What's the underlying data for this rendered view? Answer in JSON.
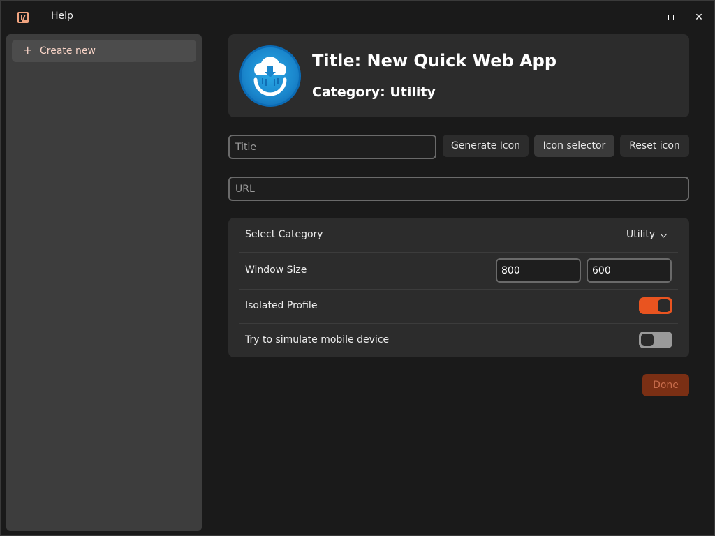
{
  "titlebar": {
    "logo_icon": "app-logo-icon",
    "help_label": "Help",
    "minimize_icon": "minimize-icon",
    "maximize_icon": "maximize-icon",
    "close_glyph": "✕"
  },
  "sidebar": {
    "create_new_icon": "plus-icon",
    "create_new_glyph": "+",
    "create_new_label": "Create new"
  },
  "header": {
    "title": "Title: New Quick Web App",
    "category": "Category: Utility"
  },
  "form": {
    "title_placeholder": "Title",
    "url_placeholder": "URL",
    "generate_icon_label": "Generate Icon",
    "icon_selector_label": "Icon selector",
    "reset_icon_label": "Reset icon"
  },
  "settings": {
    "category_label": "Select Category",
    "category_value": "Utility",
    "window_size_label": "Window Size",
    "window_width": "800",
    "window_height": "600",
    "isolated_label": "Isolated Profile",
    "isolated_enabled": true,
    "mobile_label": "Try to simulate mobile device",
    "mobile_enabled": false
  },
  "footer": {
    "done_label": "Done"
  },
  "colors": {
    "accent": "#e95420",
    "background": "#1a1a1a",
    "card": "#2c2c2c",
    "sidebar": "#3d3d3d"
  }
}
